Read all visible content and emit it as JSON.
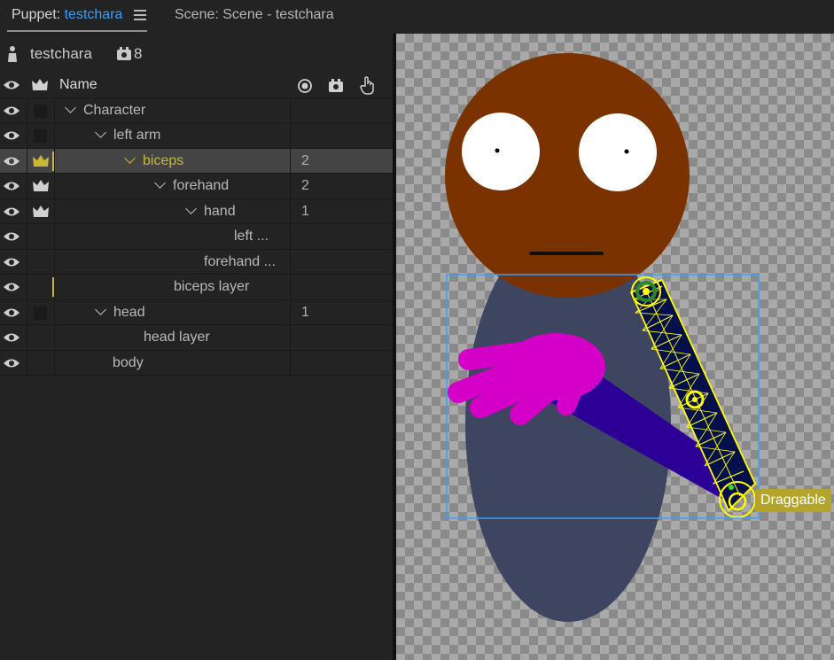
{
  "tabs": {
    "puppet_prefix": "Puppet: ",
    "puppet_name": "testchara",
    "scene_label": "Scene: Scene - testchara"
  },
  "puppet": {
    "name": "testchara",
    "behaviors_count": "8"
  },
  "table": {
    "name_header": "Name",
    "rows": [
      {
        "name": "Character",
        "count": ""
      },
      {
        "name": "left arm",
        "count": ""
      },
      {
        "name": "biceps",
        "count": "2"
      },
      {
        "name": "forehand",
        "count": "2"
      },
      {
        "name": "hand",
        "count": "1"
      },
      {
        "name": "left ...",
        "count": ""
      },
      {
        "name": "forehand ...",
        "count": ""
      },
      {
        "name": "biceps layer",
        "count": ""
      },
      {
        "name": "head",
        "count": "1"
      },
      {
        "name": "head layer",
        "count": ""
      },
      {
        "name": "body",
        "count": ""
      }
    ]
  },
  "scene": {
    "draggable_label": "Draggable"
  },
  "colors": {
    "accent_blue": "#3d9df2",
    "selection_yellow": "#c9b834",
    "head": "#7a3300",
    "body": "#3d4560",
    "hand": "#d400c8",
    "forearm": "#2c0096",
    "mesh": "#ffff00",
    "bbox": "#3aa0ff"
  }
}
